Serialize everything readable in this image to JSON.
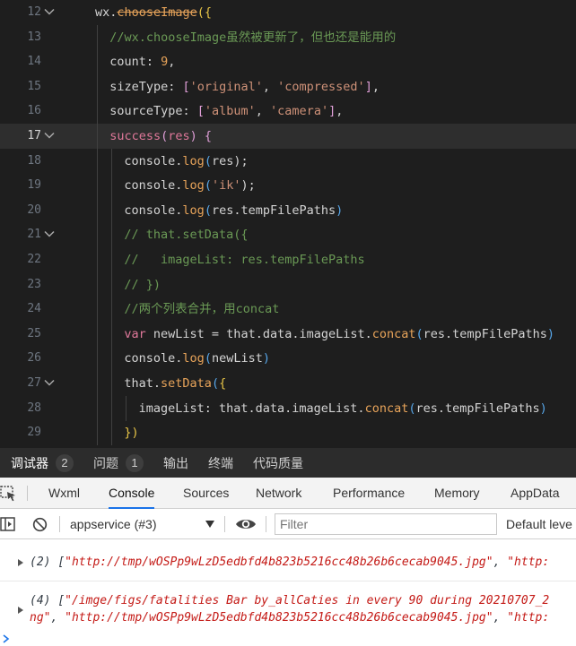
{
  "editor": {
    "lines": [
      {
        "num": "12",
        "fold": true,
        "indent": 1,
        "active": false,
        "guides": [],
        "tokens": [
          {
            "t": "wx.",
            "c": "id"
          },
          {
            "t": "chooseImage",
            "c": "fn",
            "s": true
          },
          {
            "t": "({",
            "c": "y"
          }
        ]
      },
      {
        "num": "13",
        "fold": false,
        "indent": 2,
        "active": false,
        "guides": [
          1
        ],
        "tokens": [
          {
            "t": "//wx.chooseImage虽然被更新了，但也还是能用的",
            "c": "cm"
          }
        ]
      },
      {
        "num": "14",
        "fold": false,
        "indent": 2,
        "active": false,
        "guides": [
          1
        ],
        "tokens": [
          {
            "t": "count: ",
            "c": "prop"
          },
          {
            "t": "9",
            "c": "num"
          },
          {
            "t": ",",
            "c": "id"
          }
        ]
      },
      {
        "num": "15",
        "fold": false,
        "indent": 2,
        "active": false,
        "guides": [
          1
        ],
        "tokens": [
          {
            "t": "sizeType: ",
            "c": "prop"
          },
          {
            "t": "[",
            "c": "p"
          },
          {
            "t": "'original'",
            "c": "str"
          },
          {
            "t": ", ",
            "c": "id"
          },
          {
            "t": "'compressed'",
            "c": "str"
          },
          {
            "t": "]",
            "c": "p"
          },
          {
            "t": ",",
            "c": "id"
          }
        ]
      },
      {
        "num": "16",
        "fold": false,
        "indent": 2,
        "active": false,
        "guides": [
          1
        ],
        "tokens": [
          {
            "t": "sourceType: ",
            "c": "prop"
          },
          {
            "t": "[",
            "c": "p"
          },
          {
            "t": "'album'",
            "c": "str"
          },
          {
            "t": ", ",
            "c": "id"
          },
          {
            "t": "'camera'",
            "c": "str"
          },
          {
            "t": "]",
            "c": "p"
          },
          {
            "t": ",",
            "c": "id"
          }
        ]
      },
      {
        "num": "17",
        "fold": true,
        "indent": 2,
        "active": true,
        "guides": [
          1
        ],
        "tokens": [
          {
            "t": "success",
            "c": "kw"
          },
          {
            "t": "(",
            "c": "p"
          },
          {
            "t": "res",
            "c": "kw"
          },
          {
            "t": ") ",
            "c": "p"
          },
          {
            "t": "{",
            "c": "p"
          }
        ]
      },
      {
        "num": "18",
        "fold": false,
        "indent": 3,
        "active": false,
        "guides": [
          1,
          2
        ],
        "tokens": [
          {
            "t": "console.",
            "c": "id"
          },
          {
            "t": "log",
            "c": "fn"
          },
          {
            "t": "(",
            "c": "b"
          },
          {
            "t": "res",
            "c": "id"
          },
          {
            "t": ");",
            "c": "id"
          }
        ]
      },
      {
        "num": "19",
        "fold": false,
        "indent": 3,
        "active": false,
        "guides": [
          1,
          2
        ],
        "tokens": [
          {
            "t": "console.",
            "c": "id"
          },
          {
            "t": "log",
            "c": "fn"
          },
          {
            "t": "(",
            "c": "b"
          },
          {
            "t": "'ik'",
            "c": "str"
          },
          {
            "t": ");",
            "c": "id"
          }
        ]
      },
      {
        "num": "20",
        "fold": false,
        "indent": 3,
        "active": false,
        "guides": [
          1,
          2
        ],
        "tokens": [
          {
            "t": "console.",
            "c": "id"
          },
          {
            "t": "log",
            "c": "fn"
          },
          {
            "t": "(",
            "c": "b"
          },
          {
            "t": "res.tempFilePaths",
            "c": "id"
          },
          {
            "t": ")",
            "c": "b"
          }
        ]
      },
      {
        "num": "21",
        "fold": true,
        "indent": 3,
        "active": false,
        "guides": [
          1,
          2
        ],
        "tokens": [
          {
            "t": "// that.setData({",
            "c": "cm"
          }
        ]
      },
      {
        "num": "22",
        "fold": false,
        "indent": 3,
        "active": false,
        "guides": [
          1,
          2
        ],
        "tokens": [
          {
            "t": "//   imageList: res.tempFilePaths",
            "c": "cm"
          }
        ]
      },
      {
        "num": "23",
        "fold": false,
        "indent": 3,
        "active": false,
        "guides": [
          1,
          2
        ],
        "tokens": [
          {
            "t": "// })",
            "c": "cm"
          }
        ]
      },
      {
        "num": "24",
        "fold": false,
        "indent": 3,
        "active": false,
        "guides": [
          1,
          2
        ],
        "tokens": [
          {
            "t": "//两个列表合并，用concat",
            "c": "cm"
          }
        ]
      },
      {
        "num": "25",
        "fold": false,
        "indent": 3,
        "active": false,
        "guides": [
          1,
          2
        ],
        "tokens": [
          {
            "t": "var ",
            "c": "kw"
          },
          {
            "t": "newList = that.data.imageList.",
            "c": "id"
          },
          {
            "t": "concat",
            "c": "fn"
          },
          {
            "t": "(",
            "c": "b"
          },
          {
            "t": "res.tempFilePaths",
            "c": "id"
          },
          {
            "t": ")",
            "c": "b"
          }
        ]
      },
      {
        "num": "26",
        "fold": false,
        "indent": 3,
        "active": false,
        "guides": [
          1,
          2
        ],
        "tokens": [
          {
            "t": "console.",
            "c": "id"
          },
          {
            "t": "log",
            "c": "fn"
          },
          {
            "t": "(",
            "c": "b"
          },
          {
            "t": "newList",
            "c": "id"
          },
          {
            "t": ")",
            "c": "b"
          }
        ]
      },
      {
        "num": "27",
        "fold": true,
        "indent": 3,
        "active": false,
        "guides": [
          1,
          2
        ],
        "tokens": [
          {
            "t": "that.",
            "c": "id"
          },
          {
            "t": "setData",
            "c": "fn"
          },
          {
            "t": "(",
            "c": "b"
          },
          {
            "t": "{",
            "c": "y"
          }
        ]
      },
      {
        "num": "28",
        "fold": false,
        "indent": 4,
        "active": false,
        "guides": [
          1,
          2,
          3
        ],
        "tokens": [
          {
            "t": "imageList: that.data.imageList.",
            "c": "id"
          },
          {
            "t": "concat",
            "c": "fn"
          },
          {
            "t": "(",
            "c": "b"
          },
          {
            "t": "res.tempFilePaths",
            "c": "id"
          },
          {
            "t": ")",
            "c": "b"
          }
        ]
      },
      {
        "num": "29",
        "fold": false,
        "indent": 3,
        "active": false,
        "guides": [
          1,
          2
        ],
        "tokens": [
          {
            "t": "})",
            "c": "y"
          }
        ]
      }
    ]
  },
  "panel_tabs": [
    {
      "label": "调试器",
      "badge": "2",
      "selected": true
    },
    {
      "label": "问题",
      "badge": "1",
      "selected": false
    },
    {
      "label": "输出",
      "badge": "",
      "selected": false
    },
    {
      "label": "终端",
      "badge": "",
      "selected": false
    },
    {
      "label": "代码质量",
      "badge": "",
      "selected": false
    }
  ],
  "devtools_tabs": [
    "Wxml",
    "Console",
    "Sources",
    "Network",
    "Performance",
    "Memory",
    "AppData"
  ],
  "devtools_selected": "Console",
  "context_select": "appservice (#3)",
  "filter_placeholder": "Filter",
  "levels_label": "Default leve",
  "console": {
    "msg1": {
      "count": "(2) ",
      "open": "[",
      "s1": "\"http://tmp/wOSPp9wLzD5edbfd4b823b5216cc48b26b6cecab9045.jpg\"",
      "sep": ", ",
      "s2": "\"http:"
    },
    "msg2": {
      "count": "(4) ",
      "open": "[",
      "s1": "\"/imge/figs/fatalities Bar by_allCaties in every 90 during 20210707_2",
      "s1b": "ng\"",
      "sep": ", ",
      "s2": "\"http://tmp/wOSPp9wLzD5edbfd4b823b5216cc48b26b6cecab9045.jpg\"",
      "sep2": ", ",
      "s3": "\"http:"
    }
  },
  "colors": {
    "accent": "#1a73e8",
    "editor_bg": "#1e1e1e",
    "panel_bg": "#2c2c2c"
  }
}
